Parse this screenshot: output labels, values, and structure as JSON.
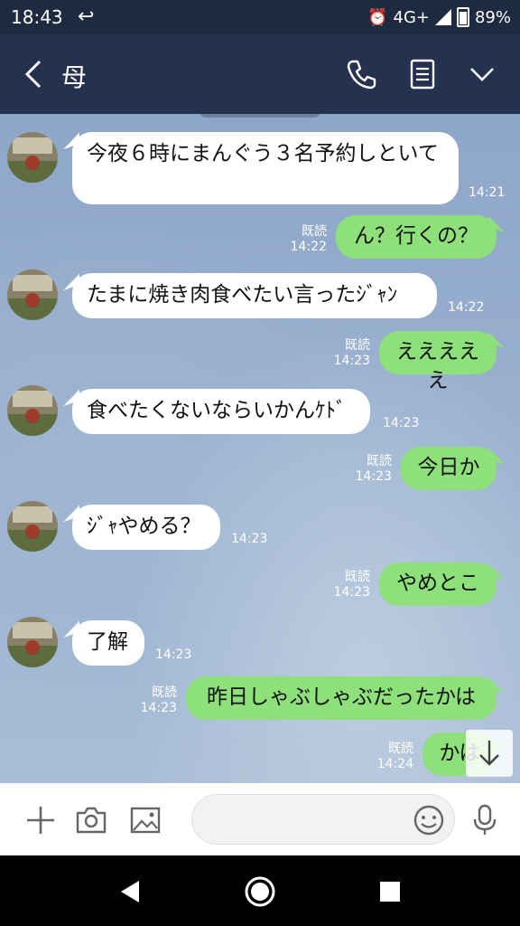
{
  "status_bar": {
    "time": "18:43",
    "network": "4G+",
    "battery": "89%"
  },
  "header": {
    "title": "母"
  },
  "messages": [
    {
      "dir": "in",
      "text": "今夜６時にまんぐう３名予約しといて",
      "time": "14:21"
    },
    {
      "dir": "out",
      "text": "ん？行くの？",
      "read": "既読",
      "time": "14:22"
    },
    {
      "dir": "in",
      "text": "たまに焼き肉食べたい言ったｼﾞｬﾝ",
      "time": "14:22"
    },
    {
      "dir": "out",
      "text": "えええええ",
      "read": "既読",
      "time": "14:23"
    },
    {
      "dir": "in",
      "text": "食べたくないならいかんｹﾄﾞ",
      "time": "14:23"
    },
    {
      "dir": "out",
      "text": "今日か",
      "read": "既読",
      "time": "14:23"
    },
    {
      "dir": "in",
      "text": "ｼﾞｬやめる？",
      "time": "14:23"
    },
    {
      "dir": "out",
      "text": "やめとこ",
      "read": "既読",
      "time": "14:23"
    },
    {
      "dir": "in",
      "text": "了解",
      "time": "14:23"
    },
    {
      "dir": "out",
      "text": "昨日しゃぶしゃぶだったかは",
      "read": "既読",
      "time": "14:23"
    },
    {
      "dir": "out",
      "text": "かは",
      "read": "既読",
      "time": "14:24"
    }
  ],
  "input": {
    "placeholder": ""
  },
  "icons": {
    "back": "chevron-left-icon",
    "call": "phone-icon",
    "notes": "notes-icon",
    "menu": "chevron-down-icon",
    "add": "plus-icon",
    "camera": "camera-icon",
    "gallery": "image-icon",
    "emoji": "smiley-icon",
    "voice": "microphone-icon",
    "scroll": "arrow-down-icon"
  },
  "colors": {
    "header": "#243250",
    "outgoing_bubble": "#8de07a",
    "incoming_bubble": "#ffffff"
  }
}
